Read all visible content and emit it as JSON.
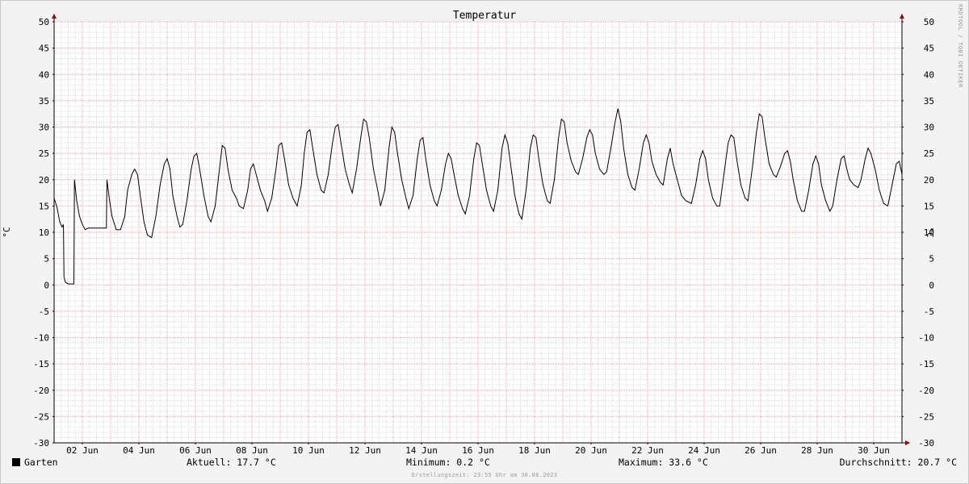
{
  "chart_data": {
    "type": "line",
    "title": "Temperatur",
    "ylabel_left": "°C",
    "ylabel_right": "°C",
    "ylim": [
      -30,
      50
    ],
    "ytick_step": 5,
    "yticks": [
      50,
      45,
      40,
      35,
      30,
      25,
      20,
      15,
      10,
      5,
      0,
      -5,
      -10,
      -15,
      -20,
      -25,
      -30
    ],
    "xlim": [
      1,
      31
    ],
    "xticks": [
      {
        "day": 2,
        "label": "02 Jun"
      },
      {
        "day": 4,
        "label": "04 Jun"
      },
      {
        "day": 6,
        "label": "06 Jun"
      },
      {
        "day": 8,
        "label": "08 Jun"
      },
      {
        "day": 10,
        "label": "10 Jun"
      },
      {
        "day": 12,
        "label": "12 Jun"
      },
      {
        "day": 14,
        "label": "14 Jun"
      },
      {
        "day": 16,
        "label": "16 Jun"
      },
      {
        "day": 18,
        "label": "18 Jun"
      },
      {
        "day": 20,
        "label": "20 Jun"
      },
      {
        "day": 22,
        "label": "22 Jun"
      },
      {
        "day": 24,
        "label": "24 Jun"
      },
      {
        "day": 26,
        "label": "26 Jun"
      },
      {
        "day": 28,
        "label": "28 Jun"
      },
      {
        "day": 30,
        "label": "30 Jun"
      }
    ],
    "grid": true,
    "series": [
      {
        "name": "Garten",
        "color": "#000000",
        "points": [
          [
            1.0,
            16.5
          ],
          [
            1.1,
            14.8
          ],
          [
            1.2,
            12.0
          ],
          [
            1.28,
            11.0
          ],
          [
            1.33,
            11.5
          ],
          [
            1.35,
            1.5
          ],
          [
            1.4,
            0.5
          ],
          [
            1.5,
            0.2
          ],
          [
            1.7,
            0.2
          ],
          [
            1.72,
            20.0
          ],
          [
            1.8,
            16.0
          ],
          [
            1.9,
            13.0
          ],
          [
            2.0,
            11.5
          ],
          [
            2.1,
            10.5
          ],
          [
            2.2,
            10.8
          ],
          [
            2.5,
            10.8
          ],
          [
            2.85,
            10.8
          ],
          [
            2.87,
            20.0
          ],
          [
            2.95,
            16.5
          ],
          [
            3.05,
            13.0
          ],
          [
            3.2,
            10.5
          ],
          [
            3.35,
            10.5
          ],
          [
            3.5,
            13.0
          ],
          [
            3.6,
            18.0
          ],
          [
            3.75,
            21.0
          ],
          [
            3.85,
            22.0
          ],
          [
            3.95,
            21.0
          ],
          [
            4.05,
            17.0
          ],
          [
            4.18,
            12.0
          ],
          [
            4.3,
            9.5
          ],
          [
            4.45,
            9.0
          ],
          [
            4.6,
            13.0
          ],
          [
            4.75,
            19.0
          ],
          [
            4.9,
            23.0
          ],
          [
            5.0,
            24.0
          ],
          [
            5.1,
            22.0
          ],
          [
            5.2,
            17.0
          ],
          [
            5.35,
            13.0
          ],
          [
            5.45,
            11.0
          ],
          [
            5.55,
            11.5
          ],
          [
            5.7,
            16.0
          ],
          [
            5.85,
            22.0
          ],
          [
            5.95,
            24.5
          ],
          [
            6.05,
            25.0
          ],
          [
            6.15,
            22.0
          ],
          [
            6.3,
            17.0
          ],
          [
            6.45,
            13.0
          ],
          [
            6.55,
            12.0
          ],
          [
            6.7,
            15.0
          ],
          [
            6.85,
            22.0
          ],
          [
            6.95,
            26.5
          ],
          [
            7.05,
            26.0
          ],
          [
            7.15,
            22.0
          ],
          [
            7.3,
            18.0
          ],
          [
            7.45,
            16.5
          ],
          [
            7.55,
            15.0
          ],
          [
            7.7,
            14.5
          ],
          [
            7.85,
            18.0
          ],
          [
            7.95,
            22.0
          ],
          [
            8.05,
            23.0
          ],
          [
            8.15,
            21.0
          ],
          [
            8.3,
            18.0
          ],
          [
            8.45,
            16.0
          ],
          [
            8.55,
            14.0
          ],
          [
            8.7,
            16.5
          ],
          [
            8.85,
            22.0
          ],
          [
            8.95,
            26.5
          ],
          [
            9.05,
            27.0
          ],
          [
            9.15,
            24.0
          ],
          [
            9.3,
            19.0
          ],
          [
            9.45,
            16.5
          ],
          [
            9.6,
            15.0
          ],
          [
            9.75,
            19.0
          ],
          [
            9.85,
            25.0
          ],
          [
            9.95,
            29.0
          ],
          [
            10.05,
            29.5
          ],
          [
            10.15,
            26.0
          ],
          [
            10.3,
            21.0
          ],
          [
            10.45,
            18.0
          ],
          [
            10.55,
            17.5
          ],
          [
            10.7,
            21.0
          ],
          [
            10.85,
            27.0
          ],
          [
            10.95,
            30.0
          ],
          [
            11.05,
            30.5
          ],
          [
            11.15,
            27.0
          ],
          [
            11.3,
            22.0
          ],
          [
            11.45,
            19.0
          ],
          [
            11.55,
            17.5
          ],
          [
            11.7,
            22.0
          ],
          [
            11.85,
            28.0
          ],
          [
            11.95,
            31.5
          ],
          [
            12.05,
            31.0
          ],
          [
            12.15,
            28.0
          ],
          [
            12.3,
            22.0
          ],
          [
            12.45,
            18.0
          ],
          [
            12.55,
            15.0
          ],
          [
            12.7,
            18.0
          ],
          [
            12.85,
            26.0
          ],
          [
            12.95,
            30.0
          ],
          [
            13.05,
            29.0
          ],
          [
            13.15,
            25.0
          ],
          [
            13.3,
            20.0
          ],
          [
            13.45,
            16.5
          ],
          [
            13.55,
            14.5
          ],
          [
            13.7,
            17.0
          ],
          [
            13.85,
            24.0
          ],
          [
            13.95,
            27.5
          ],
          [
            14.05,
            28.0
          ],
          [
            14.15,
            24.0
          ],
          [
            14.3,
            19.0
          ],
          [
            14.45,
            16.0
          ],
          [
            14.55,
            15.0
          ],
          [
            14.7,
            18.0
          ],
          [
            14.85,
            23.0
          ],
          [
            14.95,
            25.0
          ],
          [
            15.05,
            24.0
          ],
          [
            15.15,
            21.0
          ],
          [
            15.3,
            17.0
          ],
          [
            15.45,
            14.5
          ],
          [
            15.55,
            13.5
          ],
          [
            15.7,
            17.0
          ],
          [
            15.85,
            24.0
          ],
          [
            15.95,
            27.0
          ],
          [
            16.05,
            26.5
          ],
          [
            16.15,
            23.0
          ],
          [
            16.3,
            18.0
          ],
          [
            16.45,
            15.0
          ],
          [
            16.55,
            14.0
          ],
          [
            16.7,
            18.0
          ],
          [
            16.85,
            26.0
          ],
          [
            16.95,
            28.5
          ],
          [
            17.05,
            27.0
          ],
          [
            17.15,
            23.0
          ],
          [
            17.3,
            17.0
          ],
          [
            17.45,
            13.5
          ],
          [
            17.55,
            12.5
          ],
          [
            17.7,
            18.0
          ],
          [
            17.85,
            26.0
          ],
          [
            17.95,
            28.5
          ],
          [
            18.05,
            28.0
          ],
          [
            18.15,
            24.0
          ],
          [
            18.3,
            19.0
          ],
          [
            18.45,
            16.0
          ],
          [
            18.55,
            15.5
          ],
          [
            18.7,
            20.0
          ],
          [
            18.85,
            28.0
          ],
          [
            18.95,
            31.5
          ],
          [
            19.05,
            31.0
          ],
          [
            19.15,
            27.0
          ],
          [
            19.3,
            23.5
          ],
          [
            19.45,
            21.5
          ],
          [
            19.55,
            21.0
          ],
          [
            19.7,
            24.0
          ],
          [
            19.85,
            28.0
          ],
          [
            19.95,
            29.5
          ],
          [
            20.05,
            28.5
          ],
          [
            20.15,
            25.0
          ],
          [
            20.3,
            22.0
          ],
          [
            20.45,
            21.0
          ],
          [
            20.55,
            21.5
          ],
          [
            20.7,
            26.0
          ],
          [
            20.85,
            31.0
          ],
          [
            20.95,
            33.5
          ],
          [
            21.05,
            31.0
          ],
          [
            21.15,
            26.0
          ],
          [
            21.3,
            21.0
          ],
          [
            21.45,
            18.5
          ],
          [
            21.55,
            18.0
          ],
          [
            21.7,
            22.0
          ],
          [
            21.85,
            27.0
          ],
          [
            21.95,
            28.5
          ],
          [
            22.05,
            27.0
          ],
          [
            22.15,
            23.5
          ],
          [
            22.3,
            21.0
          ],
          [
            22.45,
            19.5
          ],
          [
            22.55,
            19.0
          ],
          [
            22.7,
            24.0
          ],
          [
            22.8,
            26.0
          ],
          [
            22.9,
            23.0
          ],
          [
            23.05,
            20.0
          ],
          [
            23.2,
            17.0
          ],
          [
            23.35,
            16.0
          ],
          [
            23.55,
            15.5
          ],
          [
            23.7,
            19.0
          ],
          [
            23.85,
            24.0
          ],
          [
            23.95,
            25.5
          ],
          [
            24.05,
            24.0
          ],
          [
            24.15,
            20.0
          ],
          [
            24.3,
            16.5
          ],
          [
            24.45,
            15.0
          ],
          [
            24.55,
            15.0
          ],
          [
            24.7,
            21.0
          ],
          [
            24.85,
            27.0
          ],
          [
            24.95,
            28.5
          ],
          [
            25.05,
            28.0
          ],
          [
            25.15,
            24.0
          ],
          [
            25.3,
            19.0
          ],
          [
            25.45,
            16.5
          ],
          [
            25.55,
            16.0
          ],
          [
            25.7,
            22.0
          ],
          [
            25.85,
            29.0
          ],
          [
            25.95,
            32.5
          ],
          [
            26.05,
            32.0
          ],
          [
            26.15,
            28.0
          ],
          [
            26.3,
            23.0
          ],
          [
            26.45,
            21.0
          ],
          [
            26.55,
            20.5
          ],
          [
            26.7,
            22.5
          ],
          [
            26.85,
            25.0
          ],
          [
            26.95,
            25.5
          ],
          [
            27.05,
            23.5
          ],
          [
            27.15,
            20.0
          ],
          [
            27.3,
            16.0
          ],
          [
            27.45,
            14.0
          ],
          [
            27.55,
            14.0
          ],
          [
            27.7,
            18.0
          ],
          [
            27.85,
            23.0
          ],
          [
            27.95,
            24.5
          ],
          [
            28.05,
            23.0
          ],
          [
            28.15,
            19.0
          ],
          [
            28.3,
            16.0
          ],
          [
            28.45,
            14.0
          ],
          [
            28.55,
            15.0
          ],
          [
            28.7,
            20.0
          ],
          [
            28.85,
            24.0
          ],
          [
            28.95,
            24.5
          ],
          [
            29.05,
            22.0
          ],
          [
            29.15,
            20.0
          ],
          [
            29.3,
            19.0
          ],
          [
            29.45,
            18.5
          ],
          [
            29.55,
            20.0
          ],
          [
            29.7,
            24.0
          ],
          [
            29.8,
            26.0
          ],
          [
            29.9,
            25.0
          ],
          [
            30.05,
            22.0
          ],
          [
            30.2,
            18.0
          ],
          [
            30.35,
            15.5
          ],
          [
            30.5,
            15.0
          ],
          [
            30.65,
            19.0
          ],
          [
            30.8,
            23.0
          ],
          [
            30.9,
            23.5
          ],
          [
            31.0,
            21.0
          ],
          [
            31.0,
            17.7
          ]
        ]
      }
    ]
  },
  "legend": {
    "series_name": "Garten",
    "current": "Aktuell: 17.7 °C",
    "minimum": "Minimum: 0.2 °C",
    "maximum": "Maximum: 33.6 °C",
    "average": "Durchschnitt: 20.7 °C"
  },
  "watermark": "RRDTOOL / TOBI OETIKER",
  "footer": "Erstellungszeit: 23:55 Uhr am 30.06.2023",
  "colors": {
    "background": "#f3f3f3",
    "plot_background": "#ffffff",
    "major_grid": "#e8a0a0",
    "minor_grid": "#dcdcdc",
    "axis": "#000000",
    "arrow": "#8b0000",
    "line": "#000000"
  }
}
